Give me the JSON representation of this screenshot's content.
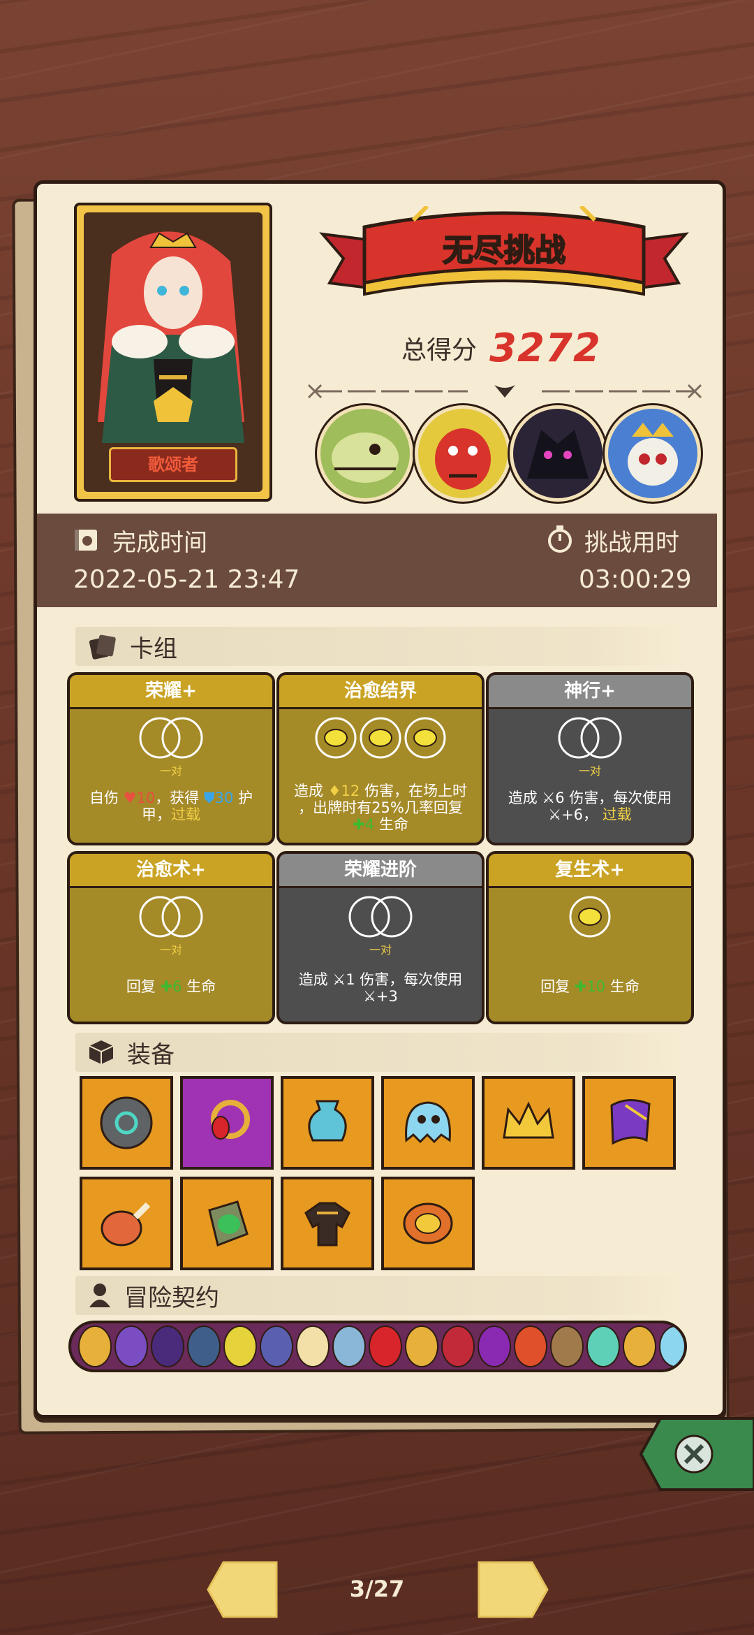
{
  "hero": {
    "name": "歌颂者"
  },
  "banner": {
    "title": "无尽挑战"
  },
  "score": {
    "label": "总得分",
    "value": "3272"
  },
  "bosses": [
    {
      "icon": "bone-dragon-icon"
    },
    {
      "icon": "red-demon-icon"
    },
    {
      "icon": "shadow-beast-icon"
    },
    {
      "icon": "skull-king-icon"
    }
  ],
  "time": {
    "finish_label": "完成时间",
    "finish_value": "2022-05-21 23:47",
    "duration_label": "挑战用时",
    "duration_value": "03:00:29"
  },
  "deck": {
    "section_label": "卡组",
    "pair_label": "一对",
    "cards": [
      {
        "title": "荣耀+",
        "style": "gold",
        "d1": "自伤",
        "d2": "10",
        "d3": "，获得",
        "d4": "30",
        "d5": "护",
        "d6": "甲，",
        "d7": "过载"
      },
      {
        "title": "治愈结界",
        "style": "gold",
        "d1": "造成",
        "d2": "12",
        "d3": "伤害，在场上时",
        "d4": "，出牌时有25%几率回复",
        "d5": "4",
        "d6": "生命"
      },
      {
        "title": "神行+",
        "style": "gray",
        "d1": "造成",
        "d2": "6",
        "d3": "伤害，每次使用",
        "d4": "+6，",
        "d5": "过载"
      },
      {
        "title": "治愈术+",
        "style": "gold",
        "d1": "回复",
        "d2": "6",
        "d3": "生命"
      },
      {
        "title": "荣耀进阶",
        "style": "gray",
        "d1": "造成",
        "d2": "1",
        "d3": "伤害，每次使用",
        "d4": "+3"
      },
      {
        "title": "复生术+",
        "style": "gold",
        "d1": "回复",
        "d2": "10",
        "d3": "生命"
      }
    ]
  },
  "equipment": {
    "section_label": "装备",
    "items": [
      {
        "icon": "rune-stone-icon"
      },
      {
        "icon": "ruby-ring-icon"
      },
      {
        "icon": "blue-vase-icon"
      },
      {
        "icon": "ghost-slime-icon"
      },
      {
        "icon": "golden-crown-icon"
      },
      {
        "icon": "purple-cloak-icon"
      },
      {
        "icon": "ham-leg-icon"
      },
      {
        "icon": "mossy-tablet-icon"
      },
      {
        "icon": "dark-armor-icon"
      },
      {
        "icon": "ornate-amulet-icon"
      }
    ]
  },
  "contract": {
    "section_label": "冒险契约"
  },
  "nav": {
    "page": "3/27"
  },
  "colors": {
    "gold": "#caa325",
    "gray": "#8a8a8a",
    "score_red": "#d8342b",
    "green": "#3cba2f"
  }
}
